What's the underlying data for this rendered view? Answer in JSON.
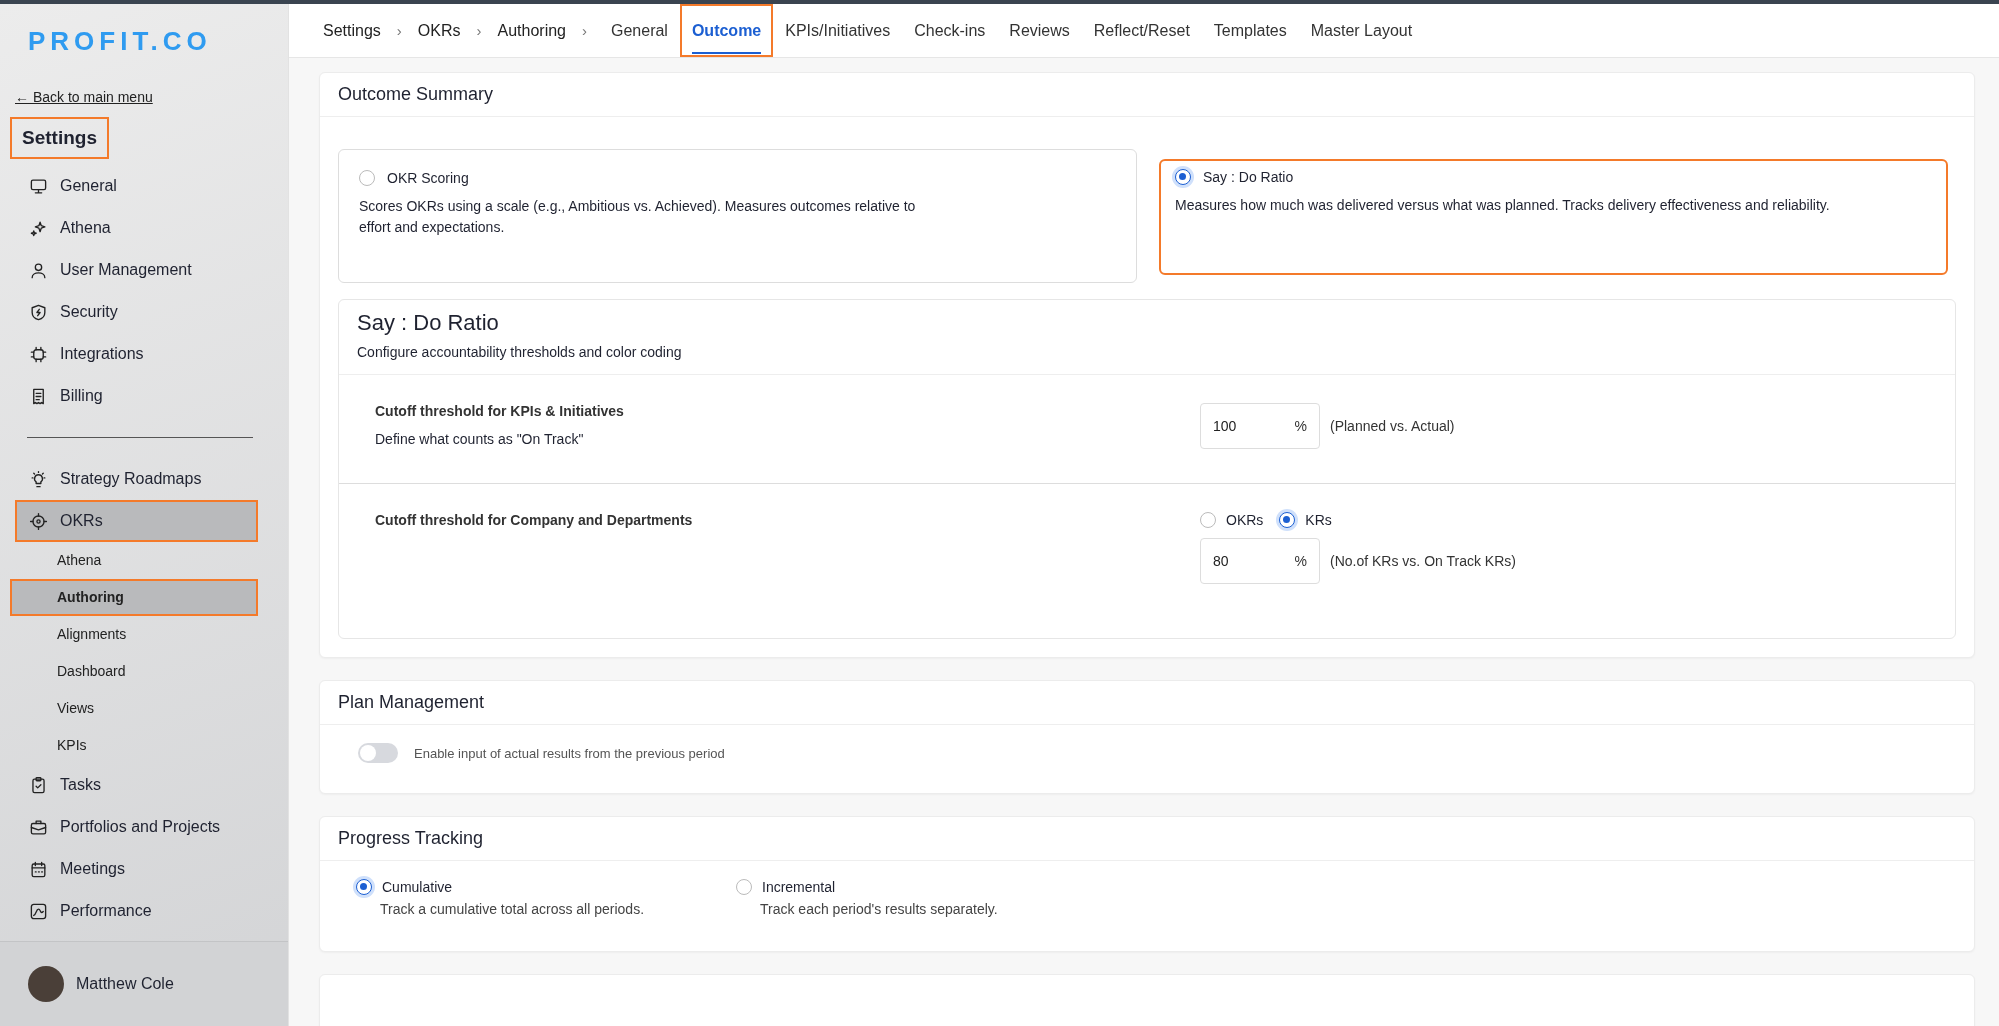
{
  "logo": {
    "text": "PROFIT.CO"
  },
  "sidebar": {
    "back_link": "← Back to main menu",
    "title": {
      "text": "Settings",
      "highlighted": true
    },
    "groups": [
      {
        "items": [
          {
            "label": "General",
            "selected": false,
            "highlighted": false
          },
          {
            "label": "Athena",
            "selected": false,
            "highlighted": false
          },
          {
            "label": "User Management",
            "selected": false,
            "highlighted": false
          },
          {
            "label": "Security",
            "selected": false,
            "highlighted": false
          },
          {
            "label": "Integrations",
            "selected": false,
            "highlighted": false
          },
          {
            "label": "Billing",
            "selected": false,
            "highlighted": false
          }
        ]
      },
      {
        "items": [
          {
            "label": "Strategy Roadmaps",
            "selected": false,
            "highlighted": false
          },
          {
            "label": "OKRs",
            "selected": true,
            "highlighted": true,
            "children": [
              {
                "label": "Athena",
                "selected": false,
                "highlighted": false
              },
              {
                "label": "Authoring",
                "selected": true,
                "highlighted": true
              },
              {
                "label": "Alignments",
                "selected": false,
                "highlighted": false
              },
              {
                "label": "Dashboard",
                "selected": false,
                "highlighted": false
              },
              {
                "label": "Views",
                "selected": false,
                "highlighted": false
              },
              {
                "label": "KPIs",
                "selected": false,
                "highlighted": false
              }
            ]
          },
          {
            "label": "Tasks",
            "selected": false,
            "highlighted": false
          },
          {
            "label": "Portfolios and Projects",
            "selected": false,
            "highlighted": false
          },
          {
            "label": "Meetings",
            "selected": false,
            "highlighted": false
          },
          {
            "label": "Performance",
            "selected": false,
            "highlighted": false
          }
        ]
      }
    ],
    "user": {
      "name": "Matthew Cole"
    }
  },
  "breadcrumb": [
    "Settings",
    "OKRs",
    "Authoring"
  ],
  "breadcrumb_separator": "›",
  "tabs": [
    {
      "label": "General",
      "selected": false,
      "highlighted": false
    },
    {
      "label": "Outcome",
      "selected": true,
      "highlighted": true
    },
    {
      "label": "KPIs/Initiatives",
      "selected": false,
      "highlighted": false
    },
    {
      "label": "Check-ins",
      "selected": false,
      "highlighted": false
    },
    {
      "label": "Reviews",
      "selected": false,
      "highlighted": false
    },
    {
      "label": "Reflect/Reset",
      "selected": false,
      "highlighted": false
    },
    {
      "label": "Templates",
      "selected": false,
      "highlighted": false
    },
    {
      "label": "Master Layout",
      "selected": false,
      "highlighted": false
    }
  ],
  "outcome_summary": {
    "title": "Outcome Summary",
    "options": [
      {
        "title": "OKR Scoring",
        "description": "Scores OKRs using a scale (e.g., Ambitious vs. Achieved). Measures outcomes relative to effort and expectations.",
        "selected": false,
        "highlighted": false
      },
      {
        "title": "Say : Do Ratio",
        "description": "Measures how much was delivered versus what was planned. Tracks delivery effectiveness and reliability.",
        "selected": true,
        "highlighted": true
      }
    ],
    "say_do": {
      "title": "Say : Do Ratio",
      "subtitle": "Configure accountability thresholds and color coding",
      "kpi_threshold": {
        "label": "Cutoff threshold for KPIs & Initiatives",
        "description": "Define what counts as \"On Track\"",
        "value": "100",
        "unit": "%",
        "note": "(Planned vs. Actual)"
      },
      "company_threshold": {
        "label": "Cutoff threshold for Company and Departments",
        "radios": [
          {
            "label": "OKRs",
            "selected": false
          },
          {
            "label": "KRs",
            "selected": true
          }
        ],
        "value": "80",
        "unit": "%",
        "note": "(No.of KRs vs. On Track KRs)"
      }
    }
  },
  "plan_management": {
    "title": "Plan Management",
    "toggle": {
      "label": "Enable input of actual results from the previous period",
      "on": false
    }
  },
  "progress_tracking": {
    "title": "Progress Tracking",
    "options": [
      {
        "label": "Cumulative",
        "description": "Track a cumulative total across all periods.",
        "selected": true
      },
      {
        "label": "Incremental",
        "description": "Track each period's results separately.",
        "selected": false
      }
    ]
  }
}
